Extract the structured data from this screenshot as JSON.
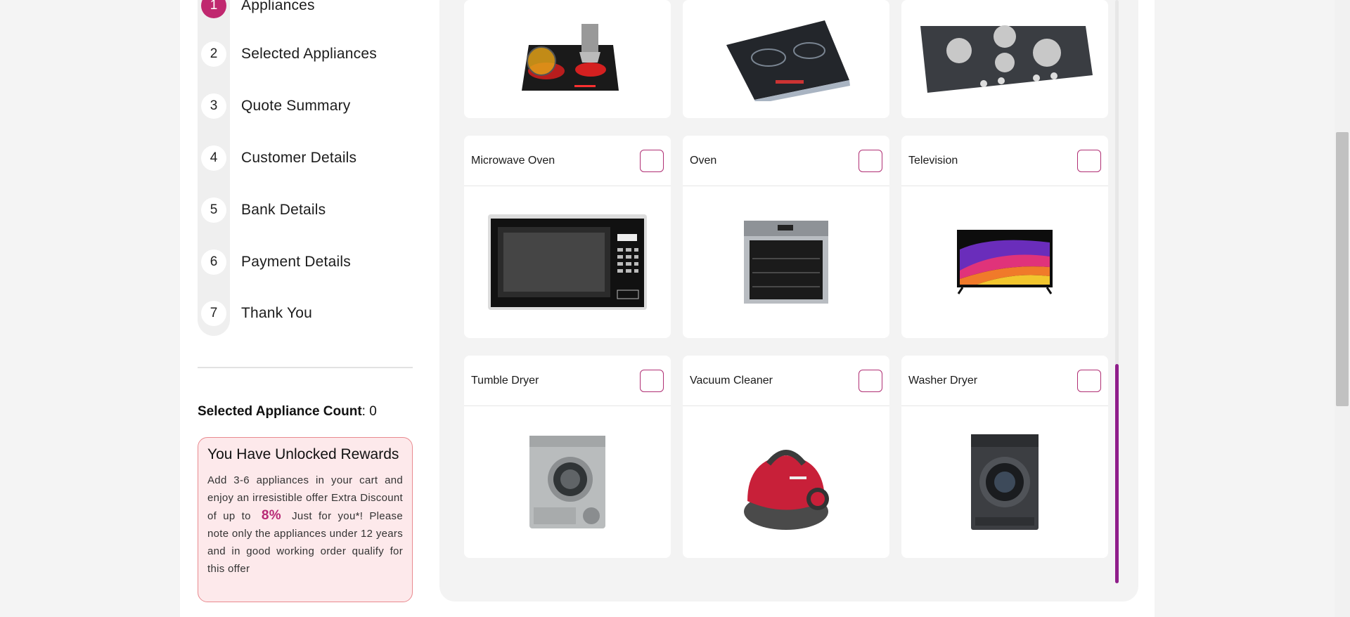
{
  "steps": [
    {
      "num": "1",
      "label": "Appliances",
      "active": true
    },
    {
      "num": "2",
      "label": "Selected Appliances"
    },
    {
      "num": "3",
      "label": "Quote Summary"
    },
    {
      "num": "4",
      "label": "Customer Details"
    },
    {
      "num": "5",
      "label": "Bank Details"
    },
    {
      "num": "6",
      "label": "Payment Details"
    },
    {
      "num": "7",
      "label": "Thank You"
    }
  ],
  "selected_count": {
    "label": "Selected Appliance Count",
    "value": ": 0"
  },
  "rewards": {
    "title": "You Have Unlocked Rewards",
    "text_before": "Add 3-6 appliances in your cart and enjoy an irresistible offer Extra Discount of up to",
    "percent": "8%",
    "text_after": "Just for you*! Please note only the appliances under 12 years and in good working order qualify for this offer"
  },
  "products_top_row": [
    {
      "icon": "ceramic-hob-icon"
    },
    {
      "icon": "induction-hob-icon"
    },
    {
      "icon": "gas-hob-icon"
    }
  ],
  "products": [
    {
      "title": "Microwave Oven",
      "icon": "microwave-icon"
    },
    {
      "title": "Oven",
      "icon": "oven-icon"
    },
    {
      "title": "Television",
      "icon": "television-icon"
    },
    {
      "title": "Tumble Dryer",
      "icon": "tumble-dryer-icon"
    },
    {
      "title": "Vacuum Cleaner",
      "icon": "vacuum-cleaner-icon"
    },
    {
      "title": "Washer Dryer",
      "icon": "washer-dryer-icon"
    }
  ],
  "colors": {
    "accent": "#c0286f",
    "scroll_thumb": "#8f1e8a",
    "reward_bg": "#fde9eb",
    "reward_border": "#e98a8f"
  }
}
